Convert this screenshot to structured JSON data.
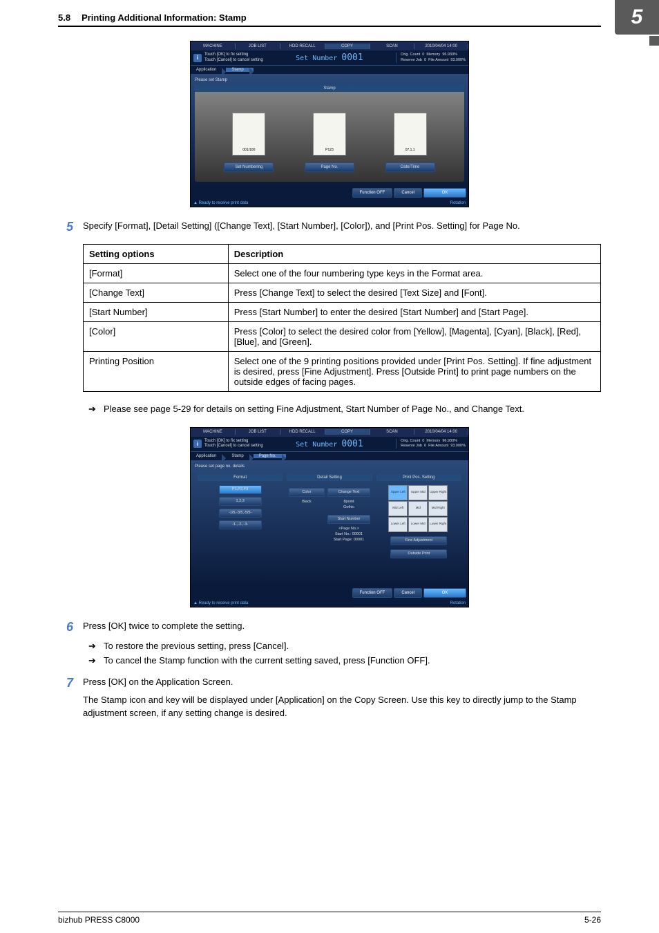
{
  "header": {
    "section": "5.8",
    "title": "Printing Additional Information: Stamp",
    "chapter": "5"
  },
  "ui1": {
    "tabs": [
      "MACHINE",
      "JOB LIST",
      "HDD RECALL",
      "COPY",
      "SCAN"
    ],
    "datetime": "2010/04/04 14:00",
    "info1": "Touch [OK] to fix setting",
    "info2": "Touch [Cancel] to cancel setting",
    "setnum_label": "Set Number",
    "setnum": "0001",
    "orig_count_l": "Orig. Count",
    "orig_count_v": "0",
    "reserve_l": "Reserve Job",
    "reserve_v": "0",
    "memory_l": "Memory",
    "memory_v": "96.930%",
    "file_l": "File Amount",
    "file_v": "93.000%",
    "crumb1": "Application",
    "crumb2": "Stamp",
    "please": "Please set Stamp",
    "sarea_title": "Stamp",
    "th1_text": "001/100",
    "th2_text": "P123",
    "th3_text": "07.1.1",
    "btn1": "Set Numbering",
    "btn2": "Page No.",
    "btn3": "Date/Time",
    "fnoff": "Function OFF",
    "cancel": "Cancel",
    "ok": "OK",
    "status": "Ready to receive print data",
    "rotation": "Rotation"
  },
  "step5": {
    "num": "5",
    "text": "Specify [Format], [Detail Setting] ([Change Text], [Start Number], [Color]), and [Print Pos. Setting] for Page No."
  },
  "table": {
    "h1": "Setting options",
    "h2": "Description",
    "r1c1": "[Format]",
    "r1c2": "Select one of the four numbering type keys in the Format area.",
    "r2c1": "[Change Text]",
    "r2c2": "Press [Change Text] to select the desired [Text Size] and [Font].",
    "r3c1": "[Start Number]",
    "r3c2": "Press [Start Number] to enter the desired [Start Number] and [Start Page].",
    "r4c1": "[Color]",
    "r4c2": "Press [Color] to select the desired color from [Yellow], [Magenta], [Cyan], [Black], [Red], [Blue], and [Green].",
    "r5c1": "Printing Position",
    "r5c2": "Select one of the 9 printing positions provided under [Print Pos. Setting]. If fine adjustment is desired, press [Fine Adjustment]. Press [Outside Print] to print page numbers on the outside edges of facing pages."
  },
  "note1": "Please see page 5-29 for details on setting Fine Adjustment, Start Number of Page No., and Change Text.",
  "ui2": {
    "crumb3": "Page No.",
    "please": "Please set page no. details",
    "col1": "Format",
    "col2": "Detail Setting",
    "col3": "Print Pos. Setting",
    "fmt1": "P1,P2,P3",
    "fmt2": "1,2,3",
    "fmt3": "-1/5,-3/5,-5/5-",
    "fmt4": "-1-,-2-,-3-",
    "colorbtn": "Color",
    "black": "Black",
    "changetext": "Change Text",
    "spoint": "8point",
    "gothic": "Gothic",
    "startnum": "Start Number",
    "pageno_l": "<Page No.>",
    "startno_l": "Start No.:",
    "startno_v": "00001",
    "startpage_l": "Start Page:",
    "startpage_v": "00001",
    "pos_ul": "Upper Left",
    "pos_um": "Upper Mid",
    "pos_ur": "Upper Right",
    "pos_ml": "Mid Left",
    "pos_mm": "Mid",
    "pos_mr": "Mid Right",
    "pos_ll": "Lower Left",
    "pos_lm": "Lower Mid",
    "pos_lr": "Lower Right",
    "fineadj": "Fine Adjustment",
    "outside": "Outside Print"
  },
  "step6": {
    "num": "6",
    "text": "Press [OK] twice to complete the setting.",
    "sub1": "To restore the previous setting, press [Cancel].",
    "sub2": "To cancel the Stamp function with the current setting saved, press [Function OFF]."
  },
  "step7": {
    "num": "7",
    "text": "Press [OK] on the Application Screen.",
    "para": "The Stamp icon and key will be displayed under [Application] on the Copy Screen. Use this key to directly jump to the Stamp adjustment screen, if any setting change is desired."
  },
  "footer": {
    "left": "bizhub PRESS C8000",
    "right": "5-26"
  }
}
